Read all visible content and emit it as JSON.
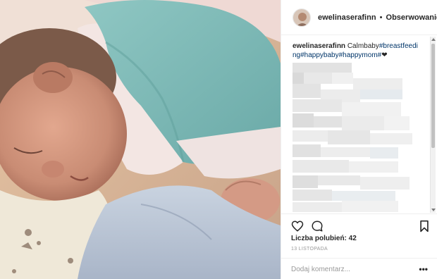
{
  "post": {
    "username": "ewelinaserafinn",
    "separator": "•",
    "follow_label": "Obserwowanie",
    "caption_user": "ewelinaserafinn",
    "caption_text": "Calmbaby",
    "caption_tags": "#breastfeeding#happybaby#happymom#",
    "caption_emoji": "❤",
    "likes_text": "Liczba polubień: 42",
    "date_text": "13 LISTOPADA",
    "comment_placeholder": "Dodaj komentarz...",
    "more_label": "•••"
  },
  "icons": {
    "heart": "heart-icon",
    "comment": "comment-icon",
    "save": "bookmark-icon",
    "more": "more-options-icon"
  },
  "colors": {
    "hashtag": "#003569",
    "muted": "#999999",
    "text": "#262626",
    "border": "#efefef"
  }
}
